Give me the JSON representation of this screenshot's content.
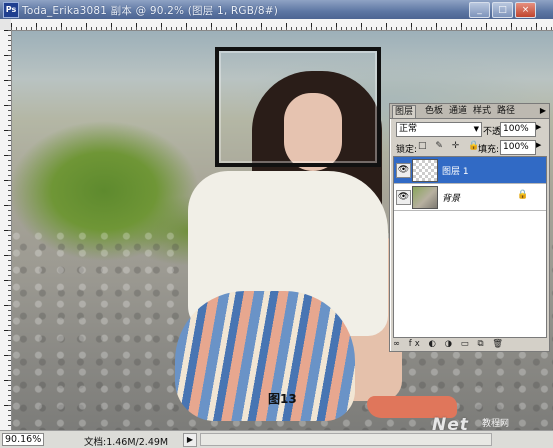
{
  "window": {
    "app_icon": "Ps",
    "title": "Toda_Erika3081 副本 @ 90.2% (图层 1, RGB/8#)",
    "buttons": {
      "minimize": "_",
      "maximize": "□",
      "close": "×"
    }
  },
  "canvas": {
    "figure_label": "图13",
    "watermark": "Net",
    "watermark_sub": "教程网"
  },
  "status": {
    "zoom": "90.16%",
    "doc_info": "文档:1.46M/2.49M",
    "arrow": "▶"
  },
  "layers_panel": {
    "tabs": [
      "图层",
      "色板",
      "通道",
      "样式",
      "路径"
    ],
    "active_tab": 0,
    "menu_arrow": "▶",
    "blend_mode": "正常",
    "dropdown_arrow": "▼",
    "opacity_label": "不透明度:",
    "opacity_value": "100%",
    "lock_label": "锁定:",
    "lock_icons": "□ ✎ ✛ 🔒",
    "fill_label": "填充:",
    "fill_value": "100%",
    "layers": [
      {
        "name": "图层 1",
        "selected": true,
        "visible": "👁"
      },
      {
        "name": "背景",
        "selected": false,
        "visible": "👁",
        "locked": "🔒"
      }
    ],
    "bottom_icons": "∞ fx ◐ ◑ ▭ ⧉ 🗑"
  }
}
